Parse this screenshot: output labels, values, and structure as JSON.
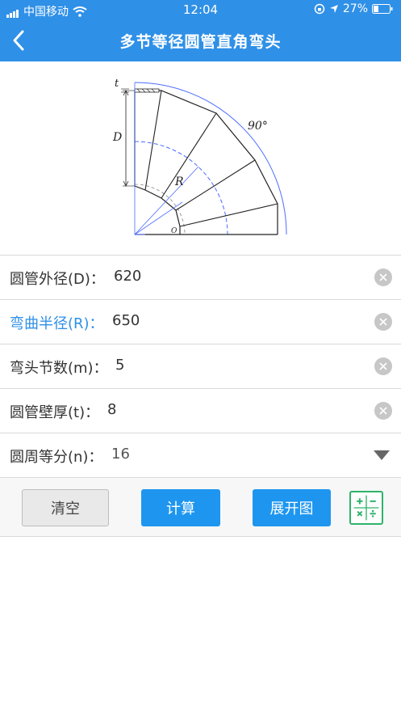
{
  "status": {
    "carrier": "中国移动",
    "time": "12:04",
    "battery": "27%"
  },
  "nav": {
    "title": "多节等径圆管直角弯头"
  },
  "diagram": {
    "label_t": "t",
    "label_D": "D",
    "label_R": "R",
    "label_angle": "90°",
    "label_O": "O"
  },
  "fields": [
    {
      "label": "圆管外径(D)：",
      "value": "620",
      "active": false
    },
    {
      "label": "弯曲半径(R)：",
      "value": "650",
      "active": true
    },
    {
      "label": "弯头节数(m)：",
      "value": "5",
      "active": false
    },
    {
      "label": "圆管壁厚(t)：",
      "value": "8",
      "active": false
    },
    {
      "label": "圆周等分(n)：",
      "value": "16",
      "active": false
    }
  ],
  "buttons": {
    "clear": "清空",
    "calculate": "计算",
    "unfold": "展开图"
  },
  "colors": {
    "primary": "#2F90E7",
    "button_blue": "#1E96F0",
    "calc_green": "#2FB36B"
  }
}
